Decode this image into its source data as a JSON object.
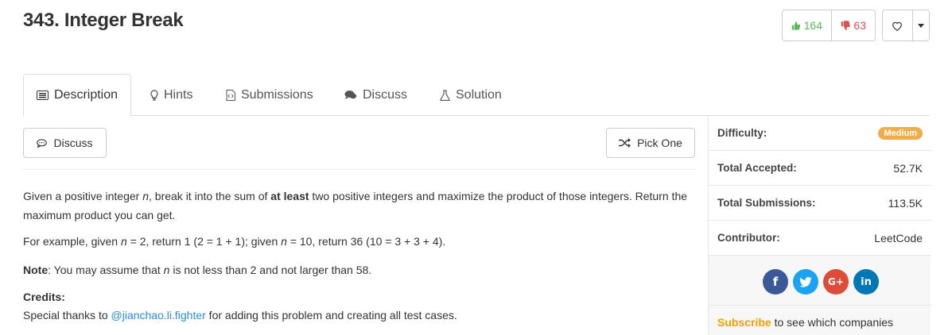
{
  "problem": {
    "title": "343. Integer Break"
  },
  "votes": {
    "likes": "164",
    "dislikes": "63"
  },
  "tabs": [
    {
      "label": "Description",
      "icon": "description-icon"
    },
    {
      "label": "Hints",
      "icon": "lightbulb-icon"
    },
    {
      "label": "Submissions",
      "icon": "code-file-icon"
    },
    {
      "label": "Discuss",
      "icon": "chat-bubbles-icon"
    },
    {
      "label": "Solution",
      "icon": "flask-icon"
    }
  ],
  "actions": {
    "discuss_label": "Discuss",
    "pick_one_label": "Pick One"
  },
  "description": {
    "p1_a": "Given a positive integer ",
    "p1_n": "n",
    "p1_b": ", break it into the sum of ",
    "p1_bold": "at least",
    "p1_c": " two positive integers and maximize the product of those integers. Return the maximum product you can get.",
    "p2_a": "For example, given ",
    "p2_n1": "n",
    "p2_b": " = 2, return 1 (2 = 1 + 1); given ",
    "p2_n2": "n",
    "p2_c": " = 10, return 36 (10 = 3 + 3 + 4).",
    "note_label": "Note",
    "note_a": ": You may assume that ",
    "note_n": "n",
    "note_b": " is not less than 2 and not larger than 58.",
    "credits_label": "Credits:",
    "credits_a": "Special thanks to ",
    "credits_link": "@jianchao.li.fighter",
    "credits_b": " for adding this problem and creating all test cases."
  },
  "sidebar": {
    "difficulty_label": "Difficulty:",
    "difficulty_value": "Medium",
    "accepted_label": "Total Accepted:",
    "accepted_value": "52.7K",
    "submissions_label": "Total Submissions:",
    "submissions_value": "113.5K",
    "contributor_label": "Contributor:",
    "contributor_value": "LeetCode",
    "social": [
      {
        "name": "facebook",
        "glyph": "f",
        "color": "#3b5998"
      },
      {
        "name": "twitter",
        "glyph": "t",
        "color": "#1da1f2"
      },
      {
        "name": "google-plus",
        "glyph": "G+",
        "color": "#dd4b39"
      },
      {
        "name": "linkedin",
        "glyph": "in",
        "color": "#0077b5"
      }
    ],
    "subscribe_link": "Subscribe",
    "subscribe_text": " to see which companies"
  },
  "colors": {
    "like": "#5cb85c",
    "dislike": "#d9534f",
    "badge": "#f0ad4e",
    "link": "#2a8ed4"
  }
}
